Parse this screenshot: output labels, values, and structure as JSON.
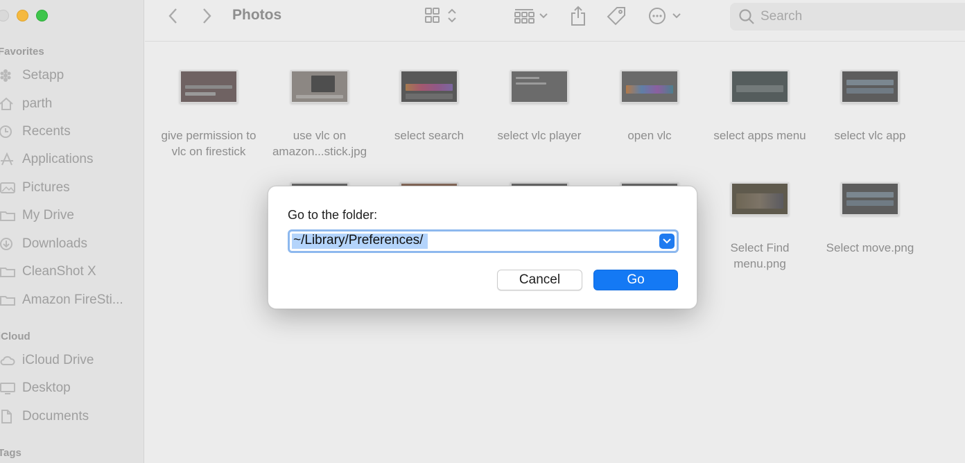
{
  "window": {
    "title": "Photos"
  },
  "sidebar": {
    "sections": [
      {
        "label": "Favorites",
        "items": [
          {
            "label": "Setapp",
            "icon": "setapp-icon"
          },
          {
            "label": "parth",
            "icon": "home-icon"
          },
          {
            "label": "Recents",
            "icon": "clock-icon"
          },
          {
            "label": "Applications",
            "icon": "applications-icon"
          },
          {
            "label": "Pictures",
            "icon": "pictures-icon"
          },
          {
            "label": "My Drive",
            "icon": "folder-icon"
          },
          {
            "label": "Downloads",
            "icon": "downloads-icon"
          },
          {
            "label": "CleanShot X",
            "icon": "folder-icon"
          },
          {
            "label": "Amazon FireSti...",
            "icon": "folder-icon"
          }
        ]
      },
      {
        "label": "iCloud",
        "items": [
          {
            "label": "iCloud Drive",
            "icon": "cloud-icon"
          },
          {
            "label": "Desktop",
            "icon": "desktop-icon"
          },
          {
            "label": "Documents",
            "icon": "document-icon"
          }
        ]
      },
      {
        "label": "Tags",
        "items": []
      }
    ]
  },
  "toolbar": {
    "search_placeholder": "Search",
    "icons": [
      "back-icon",
      "forward-icon",
      "grid-view-icon",
      "group-icon",
      "share-icon",
      "tag-icon",
      "more-icon",
      "search-icon"
    ]
  },
  "files": [
    {
      "name": "give permission to vlc on firestick",
      "row": 0
    },
    {
      "name": "use vlc on amazon...stick.jpg",
      "row": 0
    },
    {
      "name": "select search",
      "row": 0
    },
    {
      "name": "select vlc player",
      "row": 0
    },
    {
      "name": "open vlc",
      "row": 0
    },
    {
      "name": "select apps menu",
      "row": 0
    },
    {
      "name": "select vlc app",
      "row": 0
    },
    {
      "name": "Select Find menu.png",
      "row": 1
    },
    {
      "name": "Select move.png",
      "row": 1
    }
  ],
  "dialog": {
    "label": "Go to the folder:",
    "path_value": "~/Library/Preferences/",
    "cancel_label": "Cancel",
    "go_label": "Go"
  },
  "colors": {
    "accent": "#1479f4",
    "selection": "#b4d4fb",
    "focus_ring": "#8db8ee"
  }
}
